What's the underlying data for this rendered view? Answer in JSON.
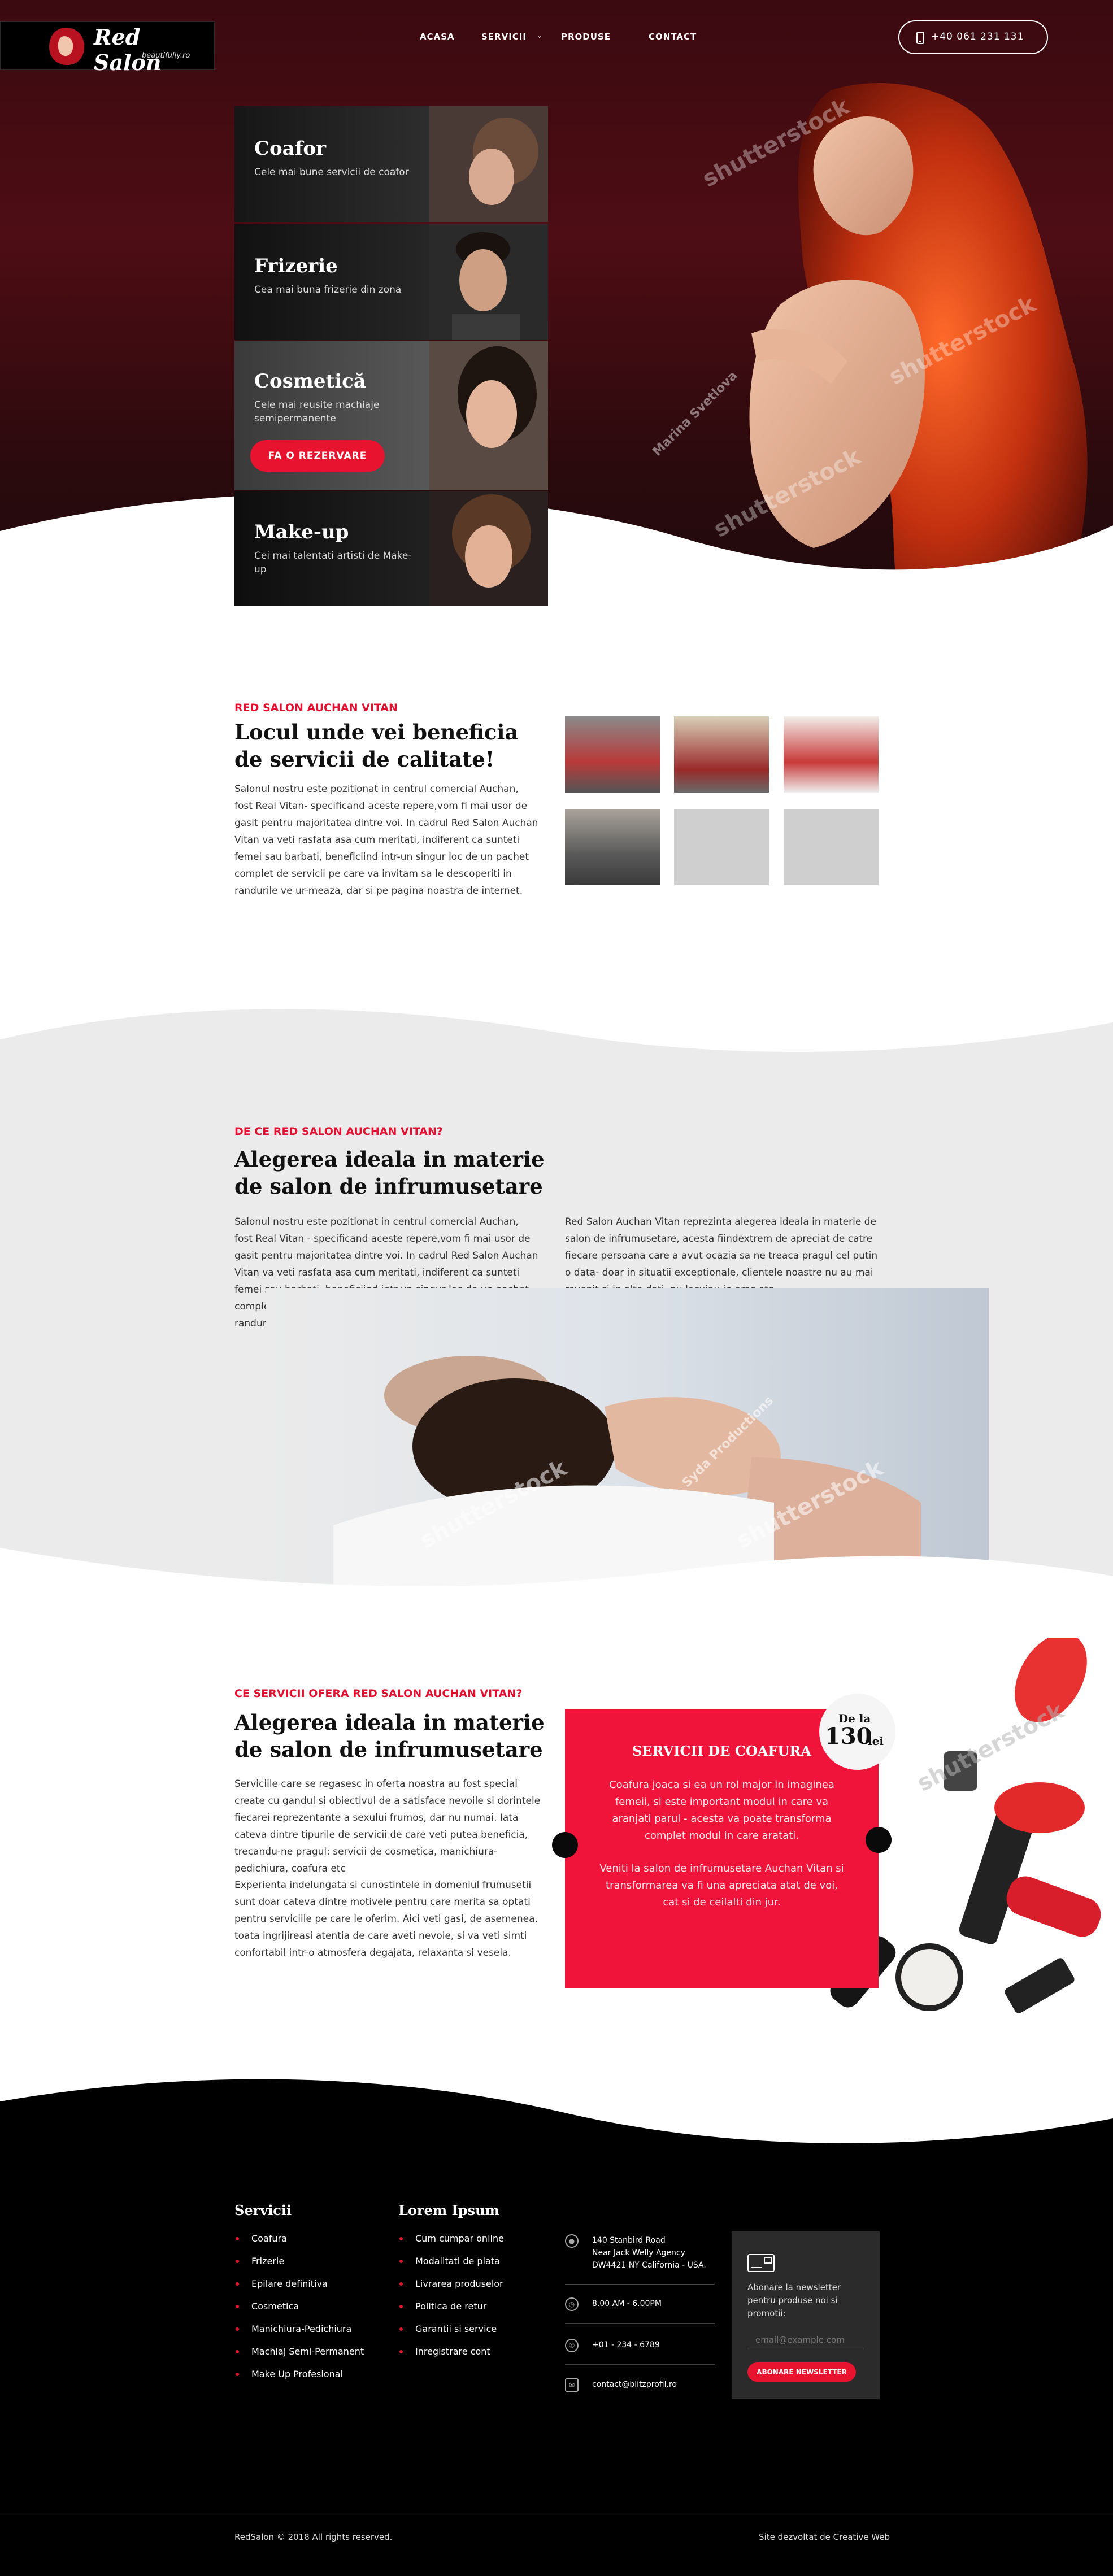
{
  "header": {
    "logo_name": "Red Salon",
    "logo_sub": "beautifully.ro",
    "nav": [
      "ACASA",
      "SERVICII",
      "PRODUSE",
      "CONTACT"
    ],
    "nav_dropdown_icon": "chevron-down-icon",
    "phone": "+40 061 231 131",
    "phone_icon": "phone-icon"
  },
  "hero": {
    "watermarks": [
      "shutterstock",
      "shutterstock",
      "shutterstock",
      "Marina Svetlova"
    ],
    "cards": [
      {
        "title": "Coafor",
        "desc": "Cele mai bune servicii de coafor"
      },
      {
        "title": "Frizerie",
        "desc": "Cea mai buna frizerie din zona"
      },
      {
        "title": "Cosmetică",
        "desc": "Cele mai reusite machiaje semipermanente",
        "button": "FA O REZERVARE"
      },
      {
        "title": "Make-up",
        "desc": "Cei mai talentati artisti de Make-up"
      }
    ]
  },
  "about": {
    "eyebrow": "RED SALON AUCHAN VITAN",
    "heading": "Locul unde vei beneficia de servicii de calitate!",
    "text": "Salonul nostru este pozitionat in centrul comercial Auchan, fost Real Vitan- specificand aceste repere,vom fi mai usor de gasit pentru majoritatea dintre voi. In cadrul Red Salon Auchan Vitan va veti rasfata asa cum meritati, indiferent ca sunteti femei sau barbati, beneficiind intr-un singur loc de un pachet complet de servicii pe care va invitam sa le descoperiti in randurile ve ur-meaza, dar si pe pagina noastra de internet."
  },
  "why": {
    "eyebrow": "DE CE RED SALON AUCHAN VITAN?",
    "heading": "Alegerea ideala in materie de salon de infrumusetare",
    "text_left": "Salonul nostru este pozitionat in centrul comercial Auchan, fost Real Vitan - specificand aceste repere,vom fi mai usor de gasit pentru majoritatea dintre voi. In cadrul Red Salon Auchan Vitan va veti rasfata asa cum meritati, indiferent ca sunteti femei sau barbati, beneficiind intr-un singur loc de un pachet complet de servicii pe care va invitam sa le descoperiti in randurile ve urmeaza, dar si pe pagina noastra de internet.",
    "text_right": "Red Salon Auchan Vitan reprezinta alegerea ideala in materie de salon de infrumusetare, acesta fiindextrem de apreciat de catre fiecare persoana care a avut ocazia sa ne treaca pragul cel putin o data- doar in situatii exceptionale, clientele noastre nu au mai revenit si in alte dati, nu locuiau in oras etc.",
    "watermarks": [
      "shutterstock",
      "shutterstock",
      "Syda Productions"
    ]
  },
  "services": {
    "eyebrow": "CE SERVICII OFERA RED SALON AUCHAN VITAN?",
    "heading": "Alegerea ideala in materie de salon de infrumusetare",
    "text1": "Serviciile care se regasesc in oferta noastra au fost special create cu gandul si obiectivul de a satisface nevoile si dorintele fiecarei reprezentante a sexului frumos, dar nu numai. Iata cateva dintre tipurile de servicii de care veti putea beneficia, trecandu-ne pragul: servicii de cosmetica, manichiura-pedichiura, coafura etc",
    "text2": "Experienta indelungata si cunostintele in domeniul frumusetii sunt doar cateva dintre motivele pentru care merita sa optati pentru serviciile pe care le oferim. Aici veti gasi, de asemenea, toata ingrijireasi atentia de care aveti nevoie, si va veti simti confortabil intr-o atmosfera degajata, relaxanta si vesela.",
    "box_title": "SERVICII DE COAFURA",
    "box_text1": "Coafura joaca si ea un rol major in imaginea femeii, si este important modul in care va aranjati parul - acesta va poate transforma complet modul in care aratati.",
    "box_text2": "Veniti la salon de infrumusetare Auchan Vitan si transformarea va fi una apreciata atat de voi, cat si de ceilalti din jur.",
    "price_label": "De la",
    "price_value": "130",
    "price_unit": "lei",
    "watermark": "shutterstock"
  },
  "footer": {
    "col1_title": "Servicii",
    "col1_items": [
      "Coafura",
      "Frizerie",
      "Epilare definitiva",
      "Cosmetica",
      "Manichiura-Pedichiura",
      "Machiaj Semi-Permanent",
      "Make Up Profesional"
    ],
    "col2_title": "Lorem Ipsum",
    "col2_items": [
      "Cum cumpar online",
      "Modalitati de plata",
      "Livrarea produselor",
      "Politica de retur",
      "Garantii si service",
      "Inregistrare cont"
    ],
    "address_line1": "140 Stanbird Road",
    "address_line2": "Near Jack Welly Agency",
    "address_line3": "DW4421 NY California - USA.",
    "hours": "8.00 AM - 6.00PM",
    "phone": "+01 - 234 - 6789",
    "email": "contact@blitzprofil.ro",
    "newsletter_text": "Abonare la newsletter pentru produse noi si promotii:",
    "newsletter_placeholder": "email@example.com",
    "newsletter_button": "ABONARE NEWSLETTER",
    "copyright": "RedSalon © 2018 All rights reserved.",
    "credit": "Site dezvoltat de Creative Web"
  },
  "colors": {
    "accent": "#e8142f",
    "hero_bg": "#4e0d14",
    "footer_bg": "#000000",
    "section_grey": "#ebebeb"
  }
}
